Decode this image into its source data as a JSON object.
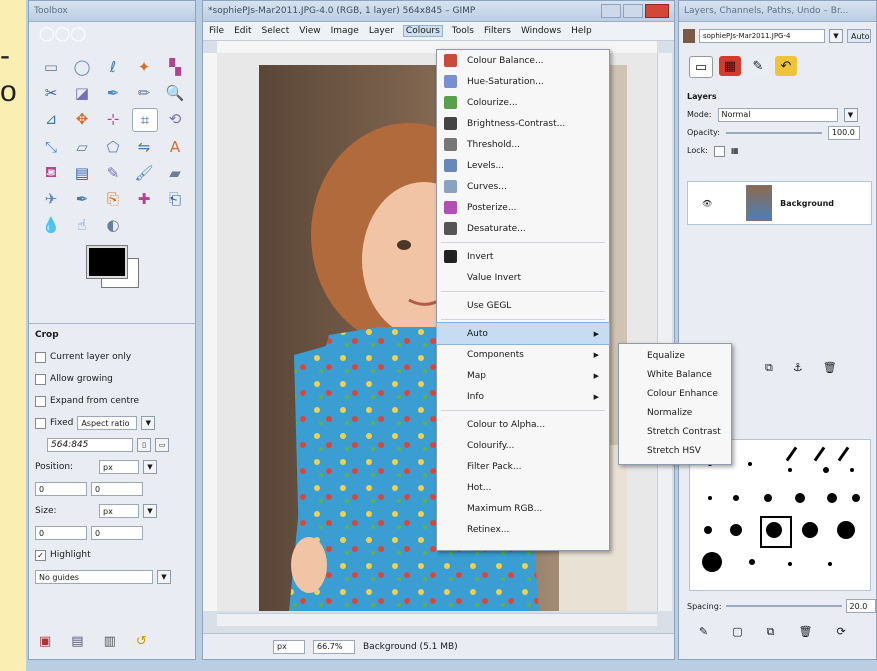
{
  "slide_glyph": "-\no",
  "toolbox": {
    "title": "Toolbox",
    "tool_icons": [
      "rect-select-icon",
      "ellipse-select-icon",
      "free-select-icon",
      "fuzzy-select-icon",
      "color-select-icon",
      "scissors-icon",
      "foreground-select-icon",
      "paths-icon",
      "color-picker-icon",
      "zoom-icon",
      "measure-icon",
      "move-icon",
      "align-icon",
      "crop-icon",
      "rotate-icon",
      "scale-icon",
      "shear-icon",
      "perspective-icon",
      "flip-icon",
      "text-icon",
      "bucket-fill-icon",
      "blend-icon",
      "pencil-icon",
      "paintbrush-icon",
      "eraser-icon",
      "airbrush-icon",
      "ink-icon",
      "clone-icon",
      "heal-icon",
      "perspective-clone-icon",
      "blur-icon",
      "smudge-icon",
      "dodge-burn-icon"
    ],
    "options": {
      "title": "Crop",
      "current_layer_only": "Current layer only",
      "allow_growing": "Allow growing",
      "expand_from_centre": "Expand from centre",
      "fixed_label": "Fixed",
      "fixed_value": "Aspect ratio",
      "ratio": "564:845",
      "position_label": "Position:",
      "position_unit": "px",
      "position_x": "0",
      "position_y": "0",
      "size_label": "Size:",
      "size_unit": "px",
      "size_w": "0",
      "size_h": "0",
      "highlight": "Highlight",
      "guides": "No guides"
    }
  },
  "image_window": {
    "title": "*sophiePJs-Mar2011.JPG-4.0 (RGB, 1 layer) 564x845 – GIMP",
    "menu": [
      "File",
      "Edit",
      "Select",
      "View",
      "Image",
      "Layer",
      "Colours",
      "Tools",
      "Filters",
      "Windows",
      "Help"
    ],
    "active_menu": "Colours",
    "status_unit": "px",
    "status_zoom": "66.7%",
    "status_text": "Background (5.1 MB)"
  },
  "colours_menu": {
    "group1": [
      {
        "label": "Colour Balance...",
        "icon": "#c84b3c"
      },
      {
        "label": "Hue-Saturation...",
        "icon": "#7a8fd0"
      },
      {
        "label": "Colourize...",
        "icon": "#5aa04a"
      },
      {
        "label": "Brightness-Contrast...",
        "icon": "#444444"
      },
      {
        "label": "Threshold...",
        "icon": "#777777"
      },
      {
        "label": "Levels...",
        "icon": "#6688bb"
      },
      {
        "label": "Curves...",
        "icon": "#8aa1c0"
      },
      {
        "label": "Posterize...",
        "icon": "#b04fb6"
      },
      {
        "label": "Desaturate...",
        "icon": "#555555"
      }
    ],
    "group2": [
      "Invert",
      "Value Invert"
    ],
    "group3": [
      "Use GEGL"
    ],
    "group4": [
      "Auto",
      "Components",
      "Map",
      "Info"
    ],
    "group5": [
      "Colour to Alpha...",
      "Colourify...",
      "Filter Pack...",
      "Hot...",
      "Maximum RGB...",
      "Retinex..."
    ]
  },
  "auto_submenu": [
    "Equalize",
    "White Balance",
    "Colour Enhance",
    "Normalize",
    "Stretch Contrast",
    "Stretch HSV"
  ],
  "dock": {
    "title": "Layers, Channels, Paths, Undo – Br...",
    "image_select": "sophiePJs-Mar2011.JPG-4",
    "auto_button": "Auto",
    "layers_label": "Layers",
    "mode_label": "Mode:",
    "mode_value": "Normal",
    "opacity_label": "Opacity:",
    "opacity_value": "100.0",
    "lock_label": "Lock:",
    "layer_name": "Background",
    "spacing_label": "Spacing:",
    "spacing_value": "20.0"
  }
}
